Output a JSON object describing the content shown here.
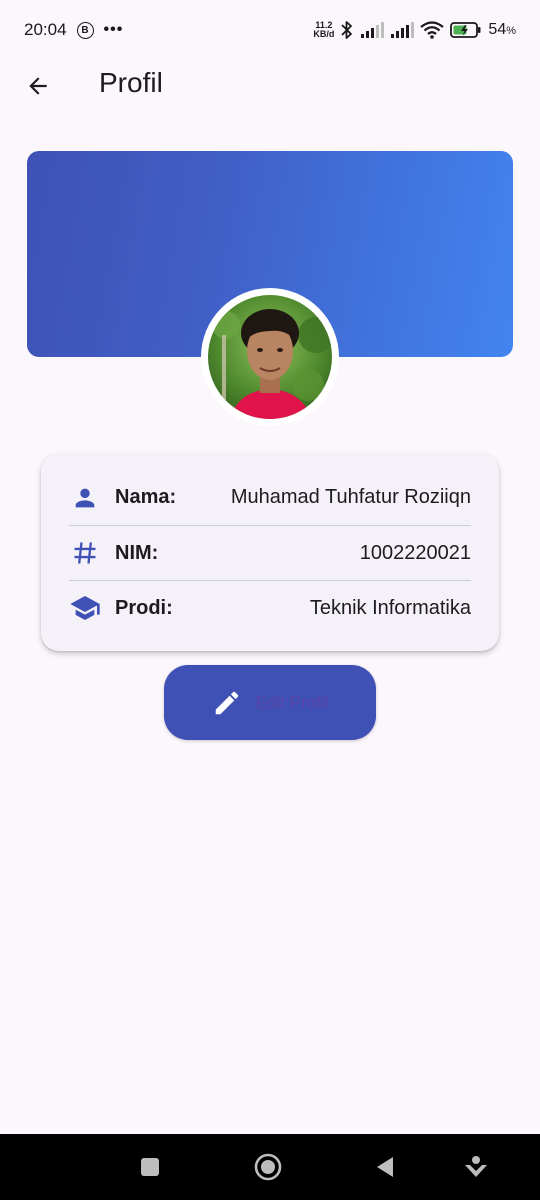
{
  "status_bar": {
    "time": "20:04",
    "notification_badge": "B",
    "more": "•••",
    "net_speed_value": "11.2",
    "net_speed_unit": "KB/d",
    "battery_percent": "54",
    "battery_unit": "%"
  },
  "app_bar": {
    "title": "Profil"
  },
  "profile": {
    "rows": [
      {
        "icon": "person-icon",
        "label": "Nama:",
        "value": "Muhamad Tuhfatur Roziiqn"
      },
      {
        "icon": "hash-icon",
        "label": "NIM:",
        "value": "1002220021"
      },
      {
        "icon": "graduation-cap-icon",
        "label": "Prodi:",
        "value": "Teknik Informatika"
      }
    ]
  },
  "edit_button": {
    "label": "Edit Profil",
    "icon": "pencil-icon"
  },
  "nav_bar": {
    "items": [
      "recents-icon",
      "home-icon",
      "back-icon",
      "assistant-icon"
    ]
  },
  "colors": {
    "primary": "#3f51b5",
    "gradient_end": "#4284ef",
    "background": "#fcf6fd",
    "card": "#f4f2f8"
  }
}
